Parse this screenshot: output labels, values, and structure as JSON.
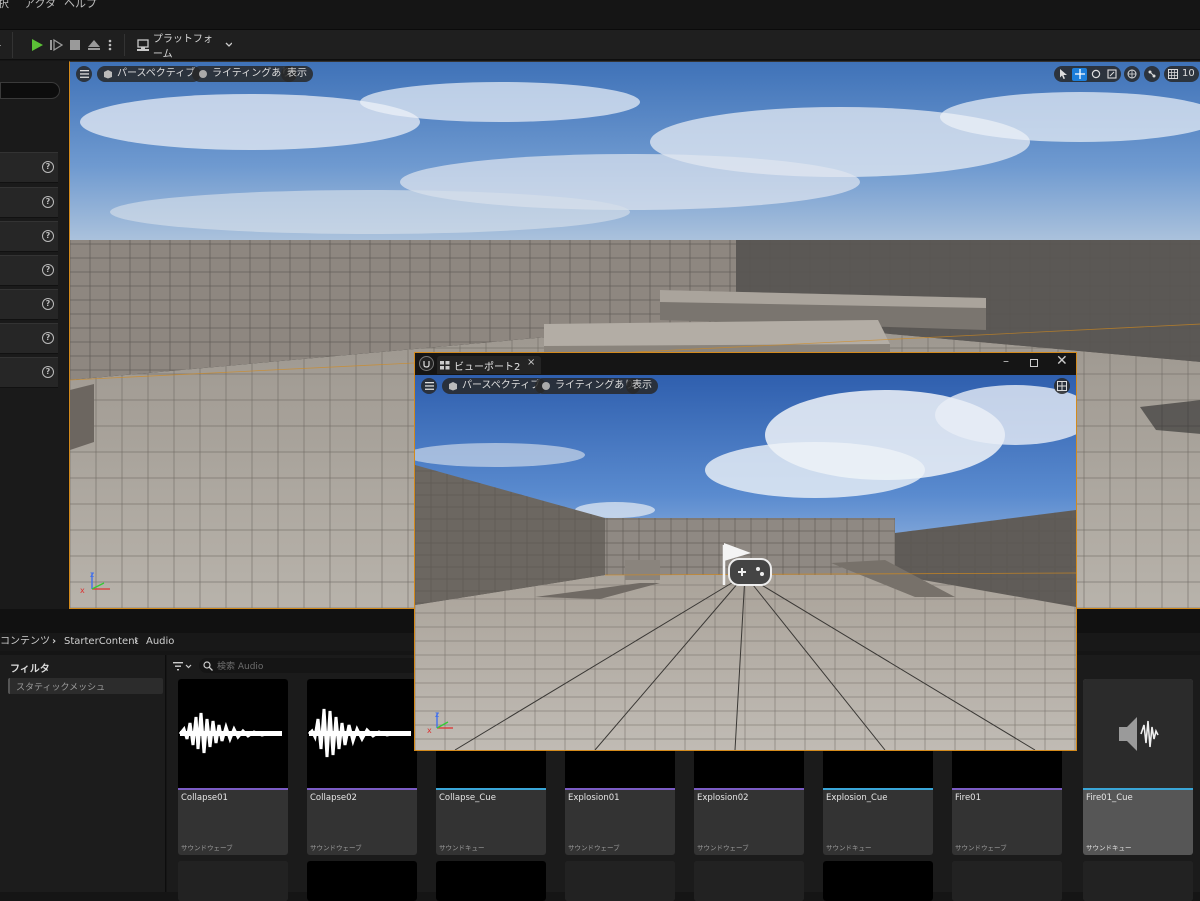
{
  "menubar": {
    "items": [
      "択",
      "アクタ",
      "ヘルプ"
    ]
  },
  "toolbar": {
    "platform_label": "プラットフォーム"
  },
  "main_viewport": {
    "perspective_label": "パースペクティブ",
    "lighting_label": "ライティングあり",
    "show_label": "表示",
    "grid_snap_value": "10"
  },
  "floating_window": {
    "tab_label": "ビューポート2",
    "perspective_label": "パースペクティブ",
    "lighting_label": "ライティングあり",
    "show_label": "表示"
  },
  "breadcrumb": {
    "items": [
      "コンテンツ",
      "StarterContent",
      "Audio"
    ]
  },
  "filter_panel": {
    "title": "フィルタ",
    "items": [
      "スタティックメッシュ"
    ]
  },
  "asset_search": {
    "placeholder": "検索 Audio"
  },
  "assets": [
    {
      "name": "Collapse01",
      "type": "サウンドウェーブ",
      "stripe": "#7b5cc4"
    },
    {
      "name": "Collapse02",
      "type": "サウンドウェーブ",
      "stripe": "#7b5cc4"
    },
    {
      "name": "Collapse_Cue",
      "type": "サウンドキュー",
      "stripe": "#3aa6d8"
    },
    {
      "name": "Explosion01",
      "type": "サウンドウェーブ",
      "stripe": "#7b5cc4"
    },
    {
      "name": "Explosion02",
      "type": "サウンドウェーブ",
      "stripe": "#7b5cc4"
    },
    {
      "name": "Explosion_Cue",
      "type": "サウンドキュー",
      "stripe": "#3aa6d8"
    },
    {
      "name": "Fire01",
      "type": "サウンドウェーブ",
      "stripe": "#7b5cc4"
    },
    {
      "name": "Fire01_Cue",
      "type": "サウンドキュー",
      "stripe": "#3aa6d8"
    }
  ],
  "colors": {
    "accent": "#d38a1c",
    "play_green": "#5bc236"
  }
}
